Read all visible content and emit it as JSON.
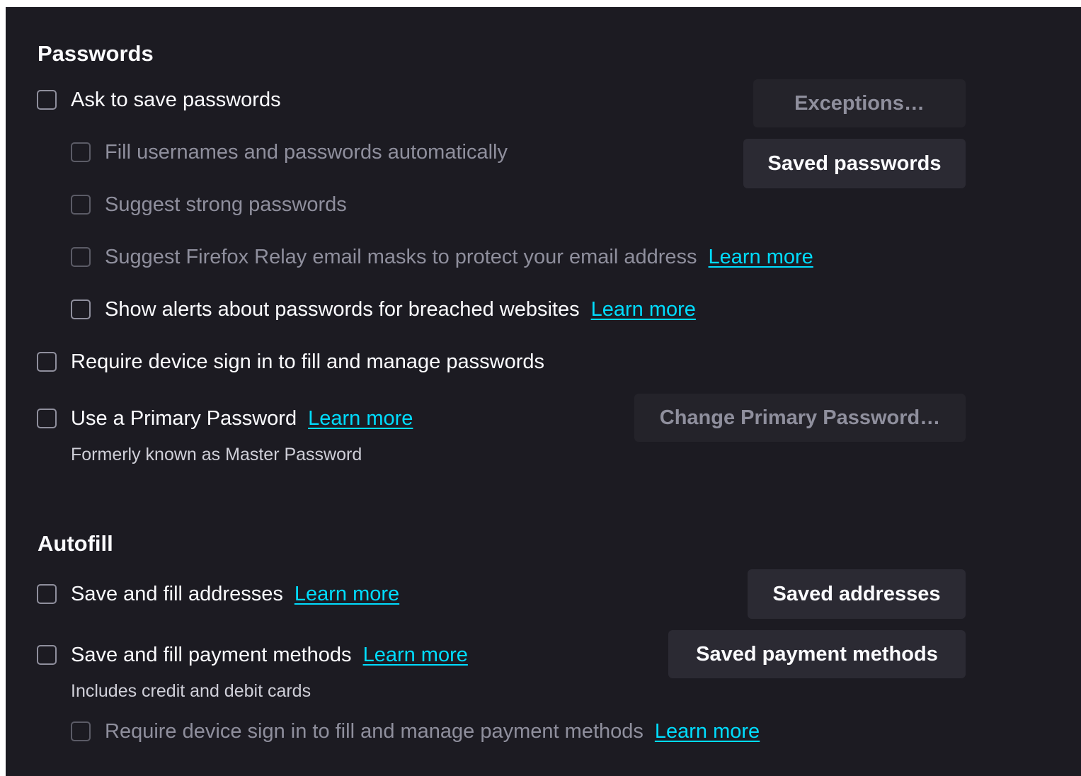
{
  "passwords": {
    "heading": "Passwords",
    "ask_to_save": {
      "label": "Ask to save passwords",
      "checked": false
    },
    "fill_auto": {
      "label": "Fill usernames and passwords automatically",
      "checked": false
    },
    "suggest_strong": {
      "label": "Suggest strong passwords",
      "checked": false
    },
    "relay": {
      "label": "Suggest Firefox Relay email masks to protect your email address",
      "link": "Learn more",
      "checked": false
    },
    "breach_alerts": {
      "label": "Show alerts about passwords for breached websites",
      "link": "Learn more",
      "checked": false
    },
    "device_signin": {
      "label": "Require device sign in to fill and manage passwords",
      "checked": false
    },
    "primary_password": {
      "label": "Use a Primary Password",
      "link": "Learn more",
      "note": "Formerly known as Master Password",
      "checked": false
    },
    "buttons": {
      "exceptions": "Exceptions…",
      "saved_passwords": "Saved passwords",
      "change_primary": "Change Primary Password…"
    }
  },
  "autofill": {
    "heading": "Autofill",
    "addresses": {
      "label": "Save and fill addresses",
      "link": "Learn more",
      "checked": false
    },
    "payments": {
      "label": "Save and fill payment methods",
      "link": "Learn more",
      "note": "Includes credit and debit cards",
      "checked": false
    },
    "payments_signin": {
      "label": "Require device sign in to fill and manage payment methods",
      "link": "Learn more",
      "checked": false
    },
    "buttons": {
      "saved_addresses": "Saved addresses",
      "saved_payments": "Saved payment methods"
    }
  },
  "colors": {
    "background": "#1c1b22",
    "button": "#2b2a33",
    "link": "#00ddff",
    "text": "#fbfbfe",
    "disabled_text": "#8f8f9d"
  }
}
